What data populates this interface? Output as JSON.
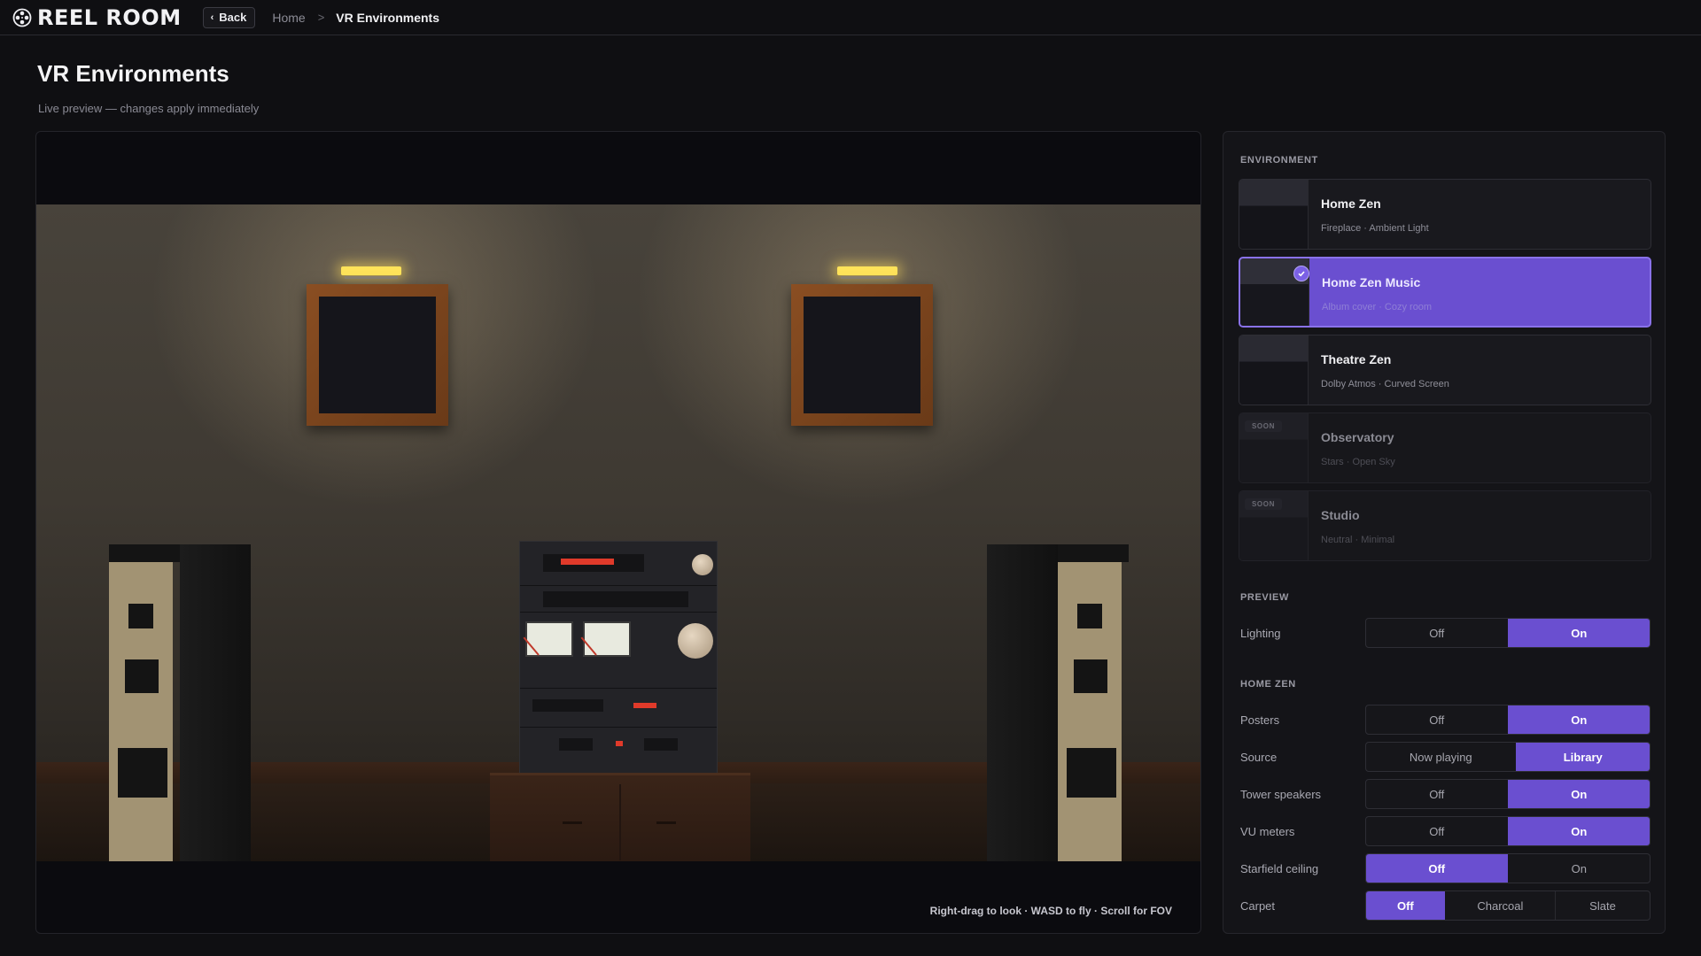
{
  "app": {
    "name": "REEL ROOM"
  },
  "nav": {
    "back_label": "Back",
    "breadcrumb_home": "Home",
    "breadcrumb_sep": ">",
    "breadcrumb_current": "VR Environments"
  },
  "page": {
    "title": "VR Environments",
    "subtitle": "Live preview — changes apply immediately"
  },
  "viewport": {
    "hint": "Right-drag to look · WASD to fly · Scroll for FOV"
  },
  "panel": {
    "environment_label": "ENVIRONMENT",
    "environments": [
      {
        "name": "Home Zen",
        "sub": "Fireplace · Ambient Light",
        "state": "normal"
      },
      {
        "name": "Home Zen Music",
        "sub": "Album cover · Cozy room",
        "state": "selected"
      },
      {
        "name": "Theatre Zen",
        "sub": "Dolby Atmos · Curved Screen",
        "state": "normal"
      },
      {
        "name": "Observatory",
        "sub": "Stars · Open Sky",
        "state": "soon",
        "badge": "SOON"
      },
      {
        "name": "Studio",
        "sub": "Neutral · Minimal",
        "state": "soon",
        "badge": "SOON"
      }
    ],
    "preview_label": "PREVIEW",
    "home_zen_label": "HOME ZEN",
    "settings": [
      {
        "label": "Lighting",
        "options": [
          "Off",
          "On"
        ],
        "selected": "On"
      },
      {
        "label": "Posters",
        "options": [
          "Off",
          "On"
        ],
        "selected": "On"
      },
      {
        "label": "Source",
        "options": [
          "Now playing",
          "Library"
        ],
        "selected": "Library"
      },
      {
        "label": "Tower speakers",
        "options": [
          "Off",
          "On"
        ],
        "selected": "On"
      },
      {
        "label": "VU meters",
        "options": [
          "Off",
          "On"
        ],
        "selected": "On"
      },
      {
        "label": "Starfield ceiling",
        "options": [
          "Off",
          "On"
        ],
        "selected": "Off"
      },
      {
        "label": "Carpet",
        "options": [
          "Off",
          "Charcoal",
          "Slate"
        ],
        "selected": "Off"
      }
    ]
  },
  "colors": {
    "accent": "#6a4fd0",
    "background": "#0f0f12",
    "panel": "#141418"
  }
}
